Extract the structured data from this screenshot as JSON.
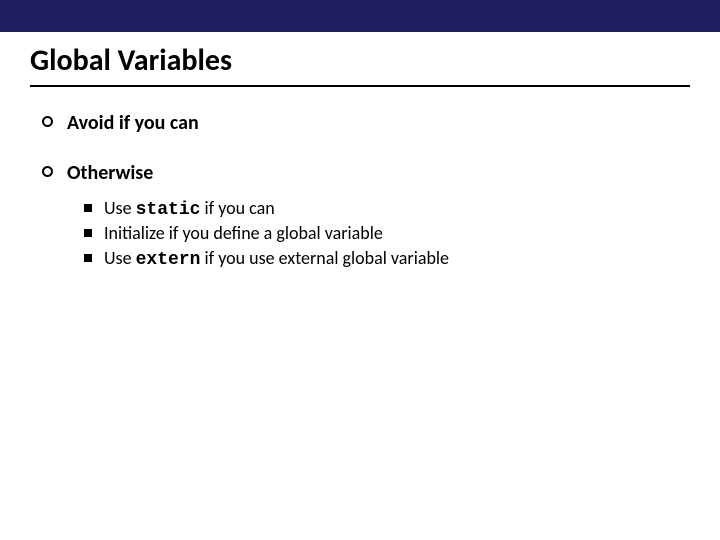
{
  "title": "Global Variables",
  "items": [
    {
      "text": "Avoid if you can"
    },
    {
      "text": "Otherwise",
      "sub": [
        {
          "pre": "Use ",
          "code": "static",
          "post": " if you can"
        },
        {
          "pre": "Initialize if you define a global variable",
          "code": "",
          "post": ""
        },
        {
          "pre": "Use ",
          "code": "extern",
          "post": " if you use external global variable"
        }
      ]
    }
  ]
}
